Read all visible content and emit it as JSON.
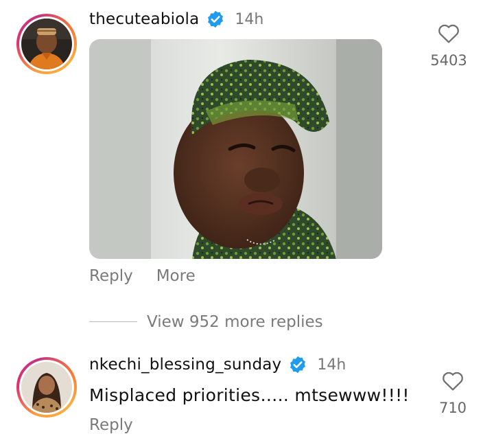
{
  "comments": [
    {
      "username": "thecuteabiola",
      "verified": true,
      "time": "14h",
      "likes": "5403",
      "reply_label": "Reply",
      "more_label": "More",
      "media": "gif-image"
    },
    {
      "username": "nkechi_blessing_sunday",
      "verified": true,
      "time": "14h",
      "text": "Misplaced priorities….. mtsewww!!!!",
      "likes": "710",
      "reply_label": "Reply"
    }
  ],
  "thread": {
    "view_more_label": "View 952 more replies"
  },
  "colors": {
    "verified": "#1f9bf0",
    "muted_text": "#7a7a7a",
    "ring_gradient": [
      "#f9a03f",
      "#e1306c",
      "#c13584",
      "#fcaf45"
    ]
  },
  "icons": [
    "verified-badge-icon",
    "heart-outline-icon"
  ]
}
